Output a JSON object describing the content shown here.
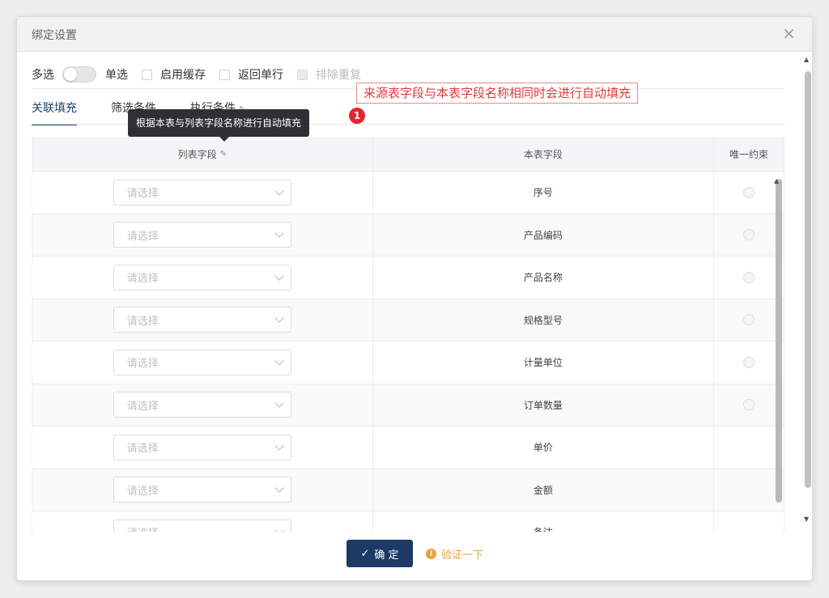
{
  "dialog": {
    "title": "绑定设置",
    "close_icon": "×"
  },
  "options": {
    "multi_label": "多选",
    "single_label": "单选",
    "cache_label": "启用缓存",
    "return_single_label": "返回单行",
    "dedupe_label": "排除重复"
  },
  "tabs": [
    {
      "label": "关联填充",
      "active": true
    },
    {
      "label": "筛选条件",
      "active": false
    },
    {
      "label": "执行条件",
      "active": false
    }
  ],
  "annotation": {
    "callout": "来源表字段与本表字段名称相同时会进行自动填充",
    "badge": "1",
    "color": "#e13a3a"
  },
  "tooltip": "根据本表与列表字段名称进行自动填充",
  "table": {
    "headers": {
      "list_field": "列表字段",
      "this_field": "本表字段",
      "unique": "唯一约束"
    },
    "placeholder": "请选择",
    "rows": [
      {
        "field": "序号",
        "radio": true
      },
      {
        "field": "产品编码",
        "radio": true
      },
      {
        "field": "产品名称",
        "radio": true
      },
      {
        "field": "规格型号",
        "radio": true
      },
      {
        "field": "计量单位",
        "radio": true
      },
      {
        "field": "订单数量",
        "radio": true
      },
      {
        "field": "单价",
        "radio": false
      },
      {
        "field": "金额",
        "radio": false
      },
      {
        "field": "备注",
        "radio": false
      }
    ]
  },
  "footer": {
    "ok_label": "确 定",
    "verify_label": "验证一下"
  },
  "colors": {
    "primary": "#1c3a63",
    "warning": "#e6a23c",
    "badge": "#e4232a"
  }
}
